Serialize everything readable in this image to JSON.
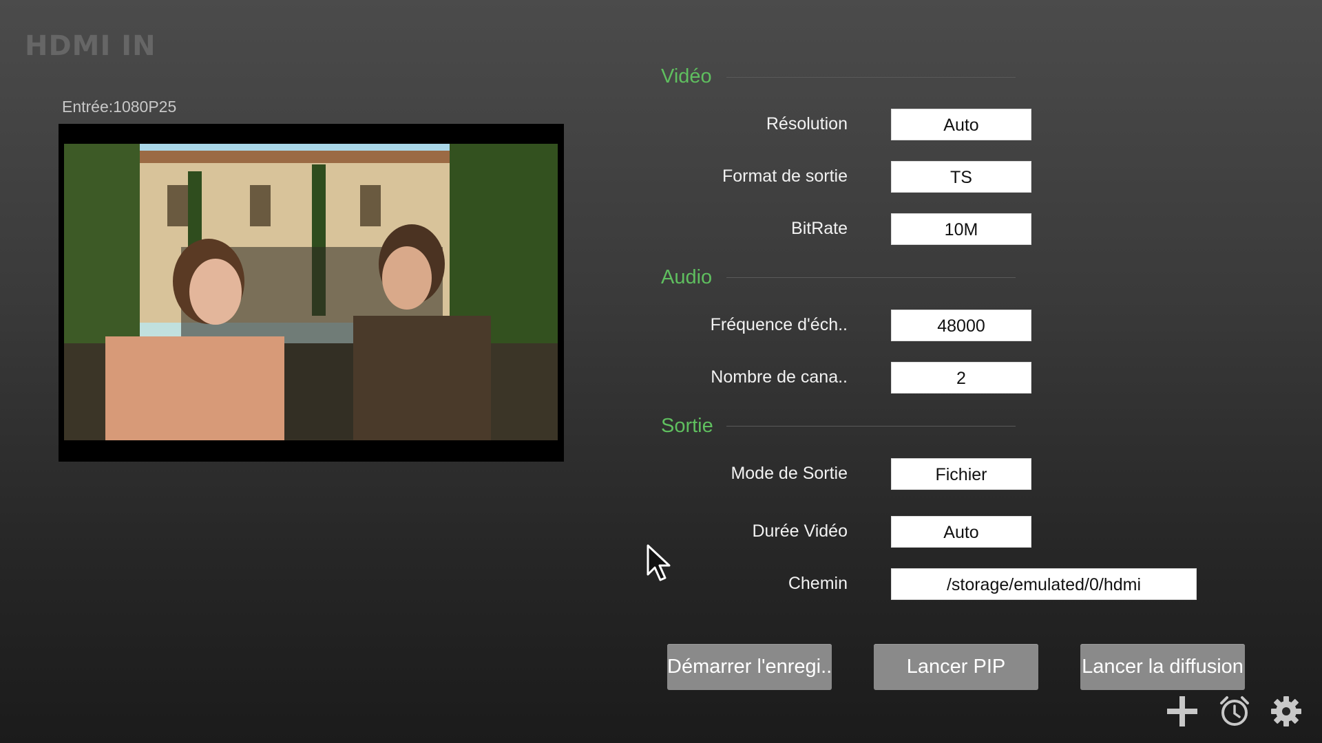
{
  "app": {
    "title": "HDMI IN"
  },
  "preview": {
    "input_label": "Entrée:1080P25"
  },
  "sections": {
    "video": {
      "header": "Vidéo",
      "fields": [
        {
          "label": "Résolution",
          "value": "Auto"
        },
        {
          "label": "Format de sortie",
          "value": "TS"
        },
        {
          "label": "BitRate",
          "value": "10M"
        }
      ]
    },
    "audio": {
      "header": "Audio",
      "fields": [
        {
          "label": "Fréquence d'éch..",
          "value": "48000"
        },
        {
          "label": "Nombre de cana..",
          "value": "2"
        }
      ]
    },
    "output": {
      "header": "Sortie",
      "fields": [
        {
          "label": "Mode de Sortie",
          "value": "Fichier"
        },
        {
          "label": "Durée Vidéo",
          "value": "Auto"
        },
        {
          "label": "Chemin",
          "value": "/storage/emulated/0/hdmi"
        }
      ]
    }
  },
  "buttons": {
    "record": "Démarrer l'enregi..",
    "pip": "Lancer PIP",
    "broadcast": "Lancer la diffusion"
  },
  "icons": {
    "add": "plus-icon",
    "timer": "alarm-clock-icon",
    "settings": "gear-icon"
  },
  "colors": {
    "section_header": "#5fbf5f",
    "button_bg": "#8a8a8a"
  }
}
